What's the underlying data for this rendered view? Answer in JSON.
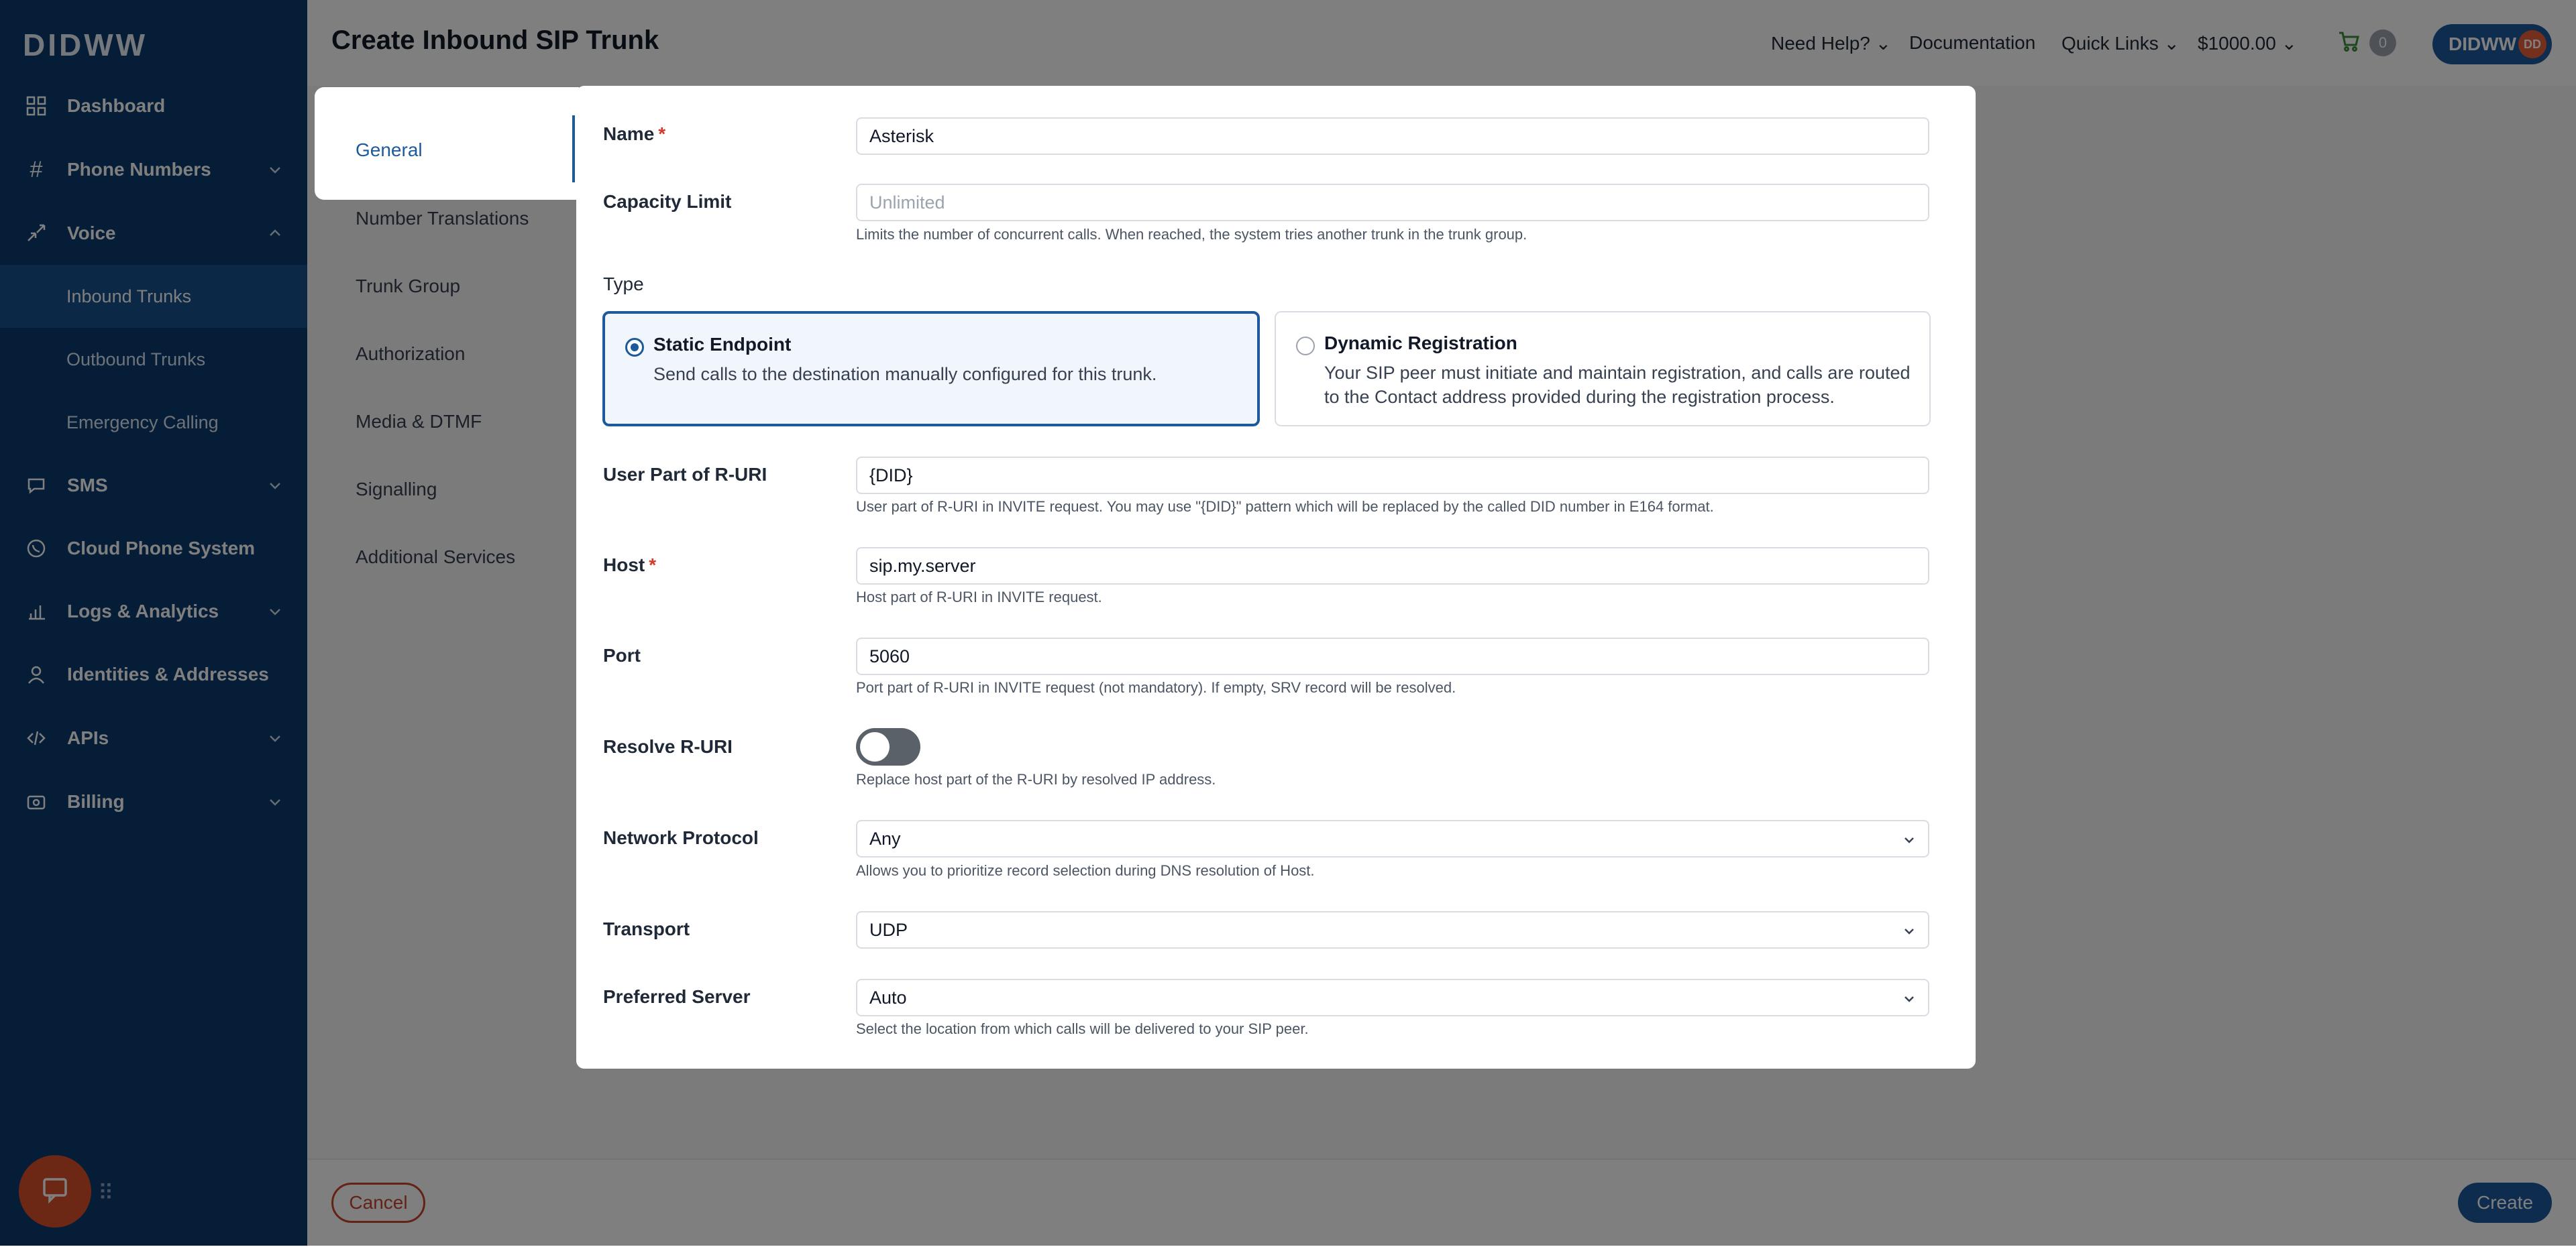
{
  "app": {
    "logo": "DIDWW",
    "page_title": "Create Inbound SIP Trunk"
  },
  "header": {
    "help": "Need Help?",
    "documentation": "Documentation",
    "quick_links": "Quick Links",
    "balance": "$1000.00",
    "cart_count": "0",
    "account": "DIDWW",
    "avatar_initials": "DD"
  },
  "sidebar": {
    "items": [
      {
        "label": "Dashboard",
        "icon": "grid-icon"
      },
      {
        "label": "Phone Numbers",
        "icon": "hash-icon"
      },
      {
        "label": "Voice",
        "icon": "phone-arrows-icon"
      },
      {
        "label": "Inbound Trunks"
      },
      {
        "label": "Outbound Trunks"
      },
      {
        "label": "Emergency Calling"
      },
      {
        "label": "SMS",
        "icon": "chat-bubble-icon"
      },
      {
        "label": "Cloud Phone System",
        "icon": "phone-circle-icon"
      },
      {
        "label": "Logs & Analytics",
        "icon": "bar-chart-icon"
      },
      {
        "label": "Identities & Addresses",
        "icon": "user-icon"
      },
      {
        "label": "APIs",
        "icon": "code-icon"
      },
      {
        "label": "Billing",
        "icon": "wallet-icon"
      }
    ]
  },
  "tabs": [
    "General",
    "Number Translations",
    "Trunk Group",
    "Authorization",
    "Media & DTMF",
    "Signalling",
    "Additional Services"
  ],
  "form": {
    "name": {
      "label": "Name",
      "value": "Asterisk"
    },
    "capacity": {
      "label": "Capacity Limit",
      "placeholder": "Unlimited",
      "help": "Limits the number of concurrent calls. When reached, the system tries another trunk in the trunk group."
    },
    "type": {
      "label": "Type",
      "static": {
        "title": "Static Endpoint",
        "desc": "Send calls to the destination manually configured for this trunk."
      },
      "dynamic": {
        "title": "Dynamic Registration",
        "desc": "Your SIP peer must initiate and maintain registration, and calls are routed to the Contact address provided during the registration process."
      }
    },
    "user_part": {
      "label": "User Part of R-URI",
      "value": "{DID}",
      "help": "User part of R-URI in INVITE request. You may use \"{DID}\" pattern which will be replaced by the called DID number in E164 format."
    },
    "host": {
      "label": "Host",
      "value": "sip.my.server",
      "help": "Host part of R-URI in INVITE request."
    },
    "port": {
      "label": "Port",
      "value": "5060",
      "help": "Port part of R-URI in INVITE request (not mandatory). If empty, SRV record will be resolved."
    },
    "resolve": {
      "label": "Resolve R-URI",
      "help": "Replace host part of the R-URI by resolved IP address."
    },
    "network": {
      "label": "Network Protocol",
      "value": "Any",
      "help": "Allows you to prioritize record selection during DNS resolution of Host."
    },
    "transport": {
      "label": "Transport",
      "value": "UDP"
    },
    "server": {
      "label": "Preferred Server",
      "value": "Auto",
      "help": "Select the location from which calls will be delivered to your SIP peer."
    },
    "required_mark": "*"
  },
  "footer": {
    "cancel": "Cancel",
    "create": "Create"
  }
}
